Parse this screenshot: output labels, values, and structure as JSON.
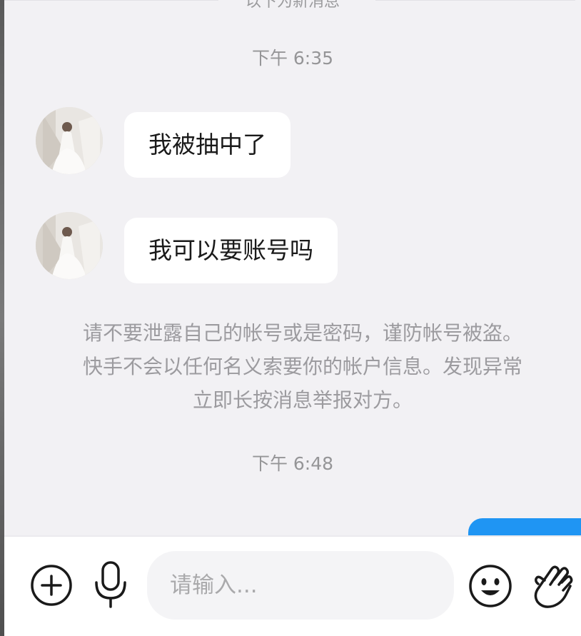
{
  "chat": {
    "new_messages_divider": "以下为新消息",
    "timestamps": [
      "下午 6:35",
      "下午 6:48"
    ],
    "messages": [
      {
        "sender": "other",
        "text": "我被抽中了"
      },
      {
        "sender": "other",
        "text": "我可以要账号吗"
      }
    ],
    "security_notice": "请不要泄露自己的帐号或是密码，谨防帐号被盗。快手不会以任何名义索要你的帐户信息。发现异常立即长按消息举报对方。"
  },
  "input_bar": {
    "placeholder": "请输入...",
    "value": "",
    "icons": [
      "add-icon",
      "microphone-icon",
      "emoji-icon",
      "hand-wave-icon"
    ]
  },
  "colors": {
    "background": "#f2f1f4",
    "bubble": "#ffffff",
    "sent_bubble": "#1f95f3",
    "meta_text": "#959597"
  }
}
